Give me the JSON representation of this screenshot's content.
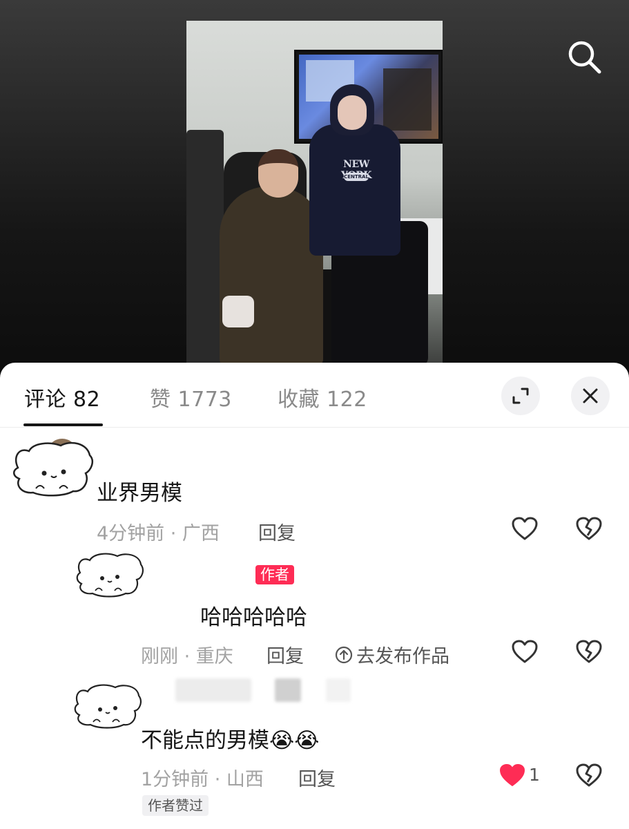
{
  "header": {
    "search_icon": "search-icon"
  },
  "tabs": [
    {
      "label": "评论 82",
      "active": true
    },
    {
      "label": "赞 1773",
      "active": false
    },
    {
      "label": "收藏 122",
      "active": false
    }
  ],
  "controls": {
    "expand_icon": "expand-icon",
    "close_icon": "close-icon"
  },
  "video": {
    "sweatshirt_text": "NEW YORK",
    "sweatshirt_sub": "CENTRAL"
  },
  "comments": [
    {
      "text": "业界男模",
      "meta": "4分钟前 · 广西",
      "reply": "回复",
      "liked": false,
      "like_count": ""
    },
    {
      "badge": "作者",
      "text": "哈哈哈哈哈",
      "meta": "刚刚 · 重庆",
      "reply": "回复",
      "publish": "去发布作品",
      "liked": false,
      "like_count": ""
    },
    {
      "text": "不能点的男模",
      "emoji": "😭😭",
      "meta": "1分钟前 · 山西",
      "reply": "回复",
      "liked": true,
      "like_count": "1",
      "badge": "作者赞过"
    }
  ],
  "colors": {
    "accent": "#fe2c55",
    "text": "#161616",
    "muted": "#a2a2a2"
  }
}
